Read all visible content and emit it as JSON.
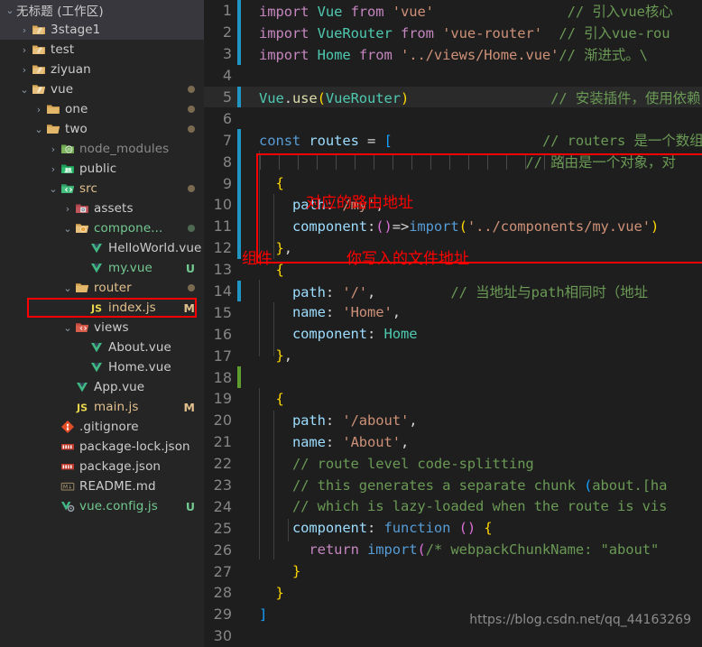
{
  "sidebar": {
    "workspace_title": "无标题 (工作区)",
    "items": [
      {
        "depth": 0,
        "chevron": "down",
        "icon": "folder-open-workspace-icon",
        "label": "无标题 (工作区)",
        "state": "",
        "kind": "workspace"
      },
      {
        "depth": 1,
        "chevron": "right",
        "icon": "folder-tan-icon",
        "label": "3stage1",
        "state": "",
        "kind": "folder",
        "selected": true
      },
      {
        "depth": 1,
        "chevron": "right",
        "icon": "folder-tan-icon",
        "label": "test",
        "state": "",
        "kind": "folder"
      },
      {
        "depth": 1,
        "chevron": "right",
        "icon": "folder-tan-icon",
        "label": "ziyuan",
        "state": "",
        "kind": "folder"
      },
      {
        "depth": 1,
        "chevron": "down",
        "icon": "folder-open-tan-icon",
        "label": "vue",
        "state": "M-dot",
        "kind": "folder"
      },
      {
        "depth": 2,
        "chevron": "right",
        "icon": "folder-plain-icon",
        "label": "one",
        "state": "M-dot",
        "kind": "folder"
      },
      {
        "depth": 2,
        "chevron": "down",
        "icon": "folder-open-plain-icon",
        "label": "two",
        "state": "M-dot",
        "kind": "folder"
      },
      {
        "depth": 3,
        "chevron": "right",
        "icon": "folder-node-modules-icon",
        "label": "node_modules",
        "state": "",
        "kind": "folder",
        "dim": true
      },
      {
        "depth": 3,
        "chevron": "right",
        "icon": "folder-public-icon",
        "label": "public",
        "state": "",
        "kind": "folder"
      },
      {
        "depth": 3,
        "chevron": "down",
        "icon": "folder-src-icon",
        "label": "src",
        "state": "M-dot",
        "kind": "folder",
        "name_color": "modified"
      },
      {
        "depth": 4,
        "chevron": "right",
        "icon": "folder-assets-icon",
        "label": "assets",
        "state": "",
        "kind": "folder"
      },
      {
        "depth": 4,
        "chevron": "down",
        "icon": "folder-components-icon",
        "label": "compone...",
        "state": "U-dot",
        "kind": "folder",
        "name_color": "untracked"
      },
      {
        "depth": 5,
        "chevron": "none",
        "icon": "vue-file-icon",
        "label": "HelloWorld.vue",
        "state": "",
        "kind": "file"
      },
      {
        "depth": 5,
        "chevron": "none",
        "icon": "vue-file-icon",
        "label": "my.vue",
        "state": "U",
        "kind": "file",
        "name_color": "untracked"
      },
      {
        "depth": 4,
        "chevron": "down",
        "icon": "folder-open-plain-icon",
        "label": "router",
        "state": "M-dot",
        "kind": "folder",
        "name_color": "modified"
      },
      {
        "depth": 5,
        "chevron": "none",
        "icon": "js-file-icon",
        "label": "index.js",
        "state": "M",
        "kind": "file",
        "name_color": "modified",
        "highlighted": true
      },
      {
        "depth": 4,
        "chevron": "down",
        "icon": "folder-views-icon",
        "label": "views",
        "state": "",
        "kind": "folder"
      },
      {
        "depth": 5,
        "chevron": "none",
        "icon": "vue-file-icon",
        "label": "About.vue",
        "state": "",
        "kind": "file"
      },
      {
        "depth": 5,
        "chevron": "none",
        "icon": "vue-file-icon",
        "label": "Home.vue",
        "state": "",
        "kind": "file"
      },
      {
        "depth": 4,
        "chevron": "none",
        "icon": "vue-file-icon",
        "label": "App.vue",
        "state": "",
        "kind": "file"
      },
      {
        "depth": 4,
        "chevron": "none",
        "icon": "js-file-icon",
        "label": "main.js",
        "state": "M",
        "kind": "file",
        "name_color": "modified"
      },
      {
        "depth": 3,
        "chevron": "none",
        "icon": "git-file-icon",
        "label": ".gitignore",
        "state": "",
        "kind": "file"
      },
      {
        "depth": 3,
        "chevron": "none",
        "icon": "npm-file-icon",
        "label": "package-lock.json",
        "state": "",
        "kind": "file"
      },
      {
        "depth": 3,
        "chevron": "none",
        "icon": "npm-file-icon",
        "label": "package.json",
        "state": "",
        "kind": "file"
      },
      {
        "depth": 3,
        "chevron": "none",
        "icon": "markdown-file-icon",
        "label": "README.md",
        "state": "",
        "kind": "file"
      },
      {
        "depth": 3,
        "chevron": "none",
        "icon": "vue-config-file-icon",
        "label": "vue.config.js",
        "state": "U",
        "kind": "file",
        "name_color": "untracked"
      }
    ]
  },
  "editor": {
    "lines": [
      {
        "n": 1,
        "gutter": "blue",
        "highlight": false
      },
      {
        "n": 2,
        "gutter": "blue",
        "highlight": false
      },
      {
        "n": 3,
        "gutter": "blue",
        "highlight": false
      },
      {
        "n": 4,
        "gutter": "",
        "highlight": false
      },
      {
        "n": 5,
        "gutter": "blue",
        "highlight": true
      },
      {
        "n": 6,
        "gutter": "",
        "highlight": false
      },
      {
        "n": 7,
        "gutter": "blue",
        "highlight": false
      },
      {
        "n": 8,
        "gutter": "blue",
        "highlight": false
      },
      {
        "n": 9,
        "gutter": "blue",
        "highlight": false
      },
      {
        "n": 10,
        "gutter": "blue",
        "highlight": false
      },
      {
        "n": 11,
        "gutter": "blue",
        "highlight": false
      },
      {
        "n": 12,
        "gutter": "blue",
        "highlight": false
      },
      {
        "n": 13,
        "gutter": "",
        "highlight": false
      },
      {
        "n": 14,
        "gutter": "blue",
        "highlight": false
      },
      {
        "n": 15,
        "gutter": "",
        "highlight": false
      },
      {
        "n": 16,
        "gutter": "",
        "highlight": false
      },
      {
        "n": 17,
        "gutter": "",
        "highlight": false
      },
      {
        "n": 18,
        "gutter": "green",
        "highlight": false
      },
      {
        "n": 19,
        "gutter": "",
        "highlight": false
      },
      {
        "n": 20,
        "gutter": "",
        "highlight": false
      },
      {
        "n": 21,
        "gutter": "",
        "highlight": false
      },
      {
        "n": 22,
        "gutter": "",
        "highlight": false
      },
      {
        "n": 23,
        "gutter": "",
        "highlight": false
      },
      {
        "n": 24,
        "gutter": "",
        "highlight": false
      },
      {
        "n": 25,
        "gutter": "",
        "highlight": false
      },
      {
        "n": 26,
        "gutter": "",
        "highlight": false
      },
      {
        "n": 27,
        "gutter": "",
        "highlight": false
      },
      {
        "n": 28,
        "gutter": "",
        "highlight": false
      },
      {
        "n": 29,
        "gutter": "",
        "highlight": false
      },
      {
        "n": 30,
        "gutter": "",
        "highlight": false
      }
    ],
    "code_text": {
      "l1": "import Vue from 'vue'",
      "l1c": "// 引入vue核心",
      "l2": "import VueRouter from 'vue-router'",
      "l2c": "// 引入vue-rou",
      "l3": "import Home from '../views/Home.vue'",
      "l3c": "// 渐进式。\\",
      "l5": "Vue.use(VueRouter)",
      "l5c": "// 安装插件，使用依赖",
      "l7": "const routes = [",
      "l7c": "// routers 是一个数组",
      "l8c": "// 路由是一个对象，对",
      "l9": "{",
      "l10": "path:'/my',",
      "l11": "component:()=>import('../components/my.vue')",
      "l12": "},",
      "l13": "{",
      "l14": "path: '/',",
      "l14c": "// 当地址与path相同时（地址",
      "l15": "name: 'Home',",
      "l16": "component: Home",
      "l17": "},",
      "l19": "{",
      "l20": "path: '/about',",
      "l21": "name: 'About',",
      "l22": "// route level code-splitting",
      "l23": "// this generates a separate chunk (about.[ha",
      "l24": "// which is lazy-loaded when the route is vis",
      "l25": "component: function () {",
      "l26": "return import(/* webpackChunkName: \"about\"",
      "l27": "}",
      "l28": "}",
      "l29": "]"
    },
    "annotations": [
      {
        "id": "anno-route-address",
        "text": "对应的路由地址"
      },
      {
        "id": "anno-component",
        "text": "组件"
      },
      {
        "id": "anno-file-address",
        "text": "你写入的文件地址"
      }
    ],
    "watermark": "https://blog.csdn.net/qq_44163269"
  },
  "colors": {
    "sidebar_bg": "#252526",
    "editor_bg": "#1e1e1e",
    "annotation_red": "#ff0000",
    "modified_amber": "#e2c08d",
    "untracked_green": "#73c991",
    "gutter_blue": "#2196c4",
    "gutter_green": "#5d9e2e"
  }
}
